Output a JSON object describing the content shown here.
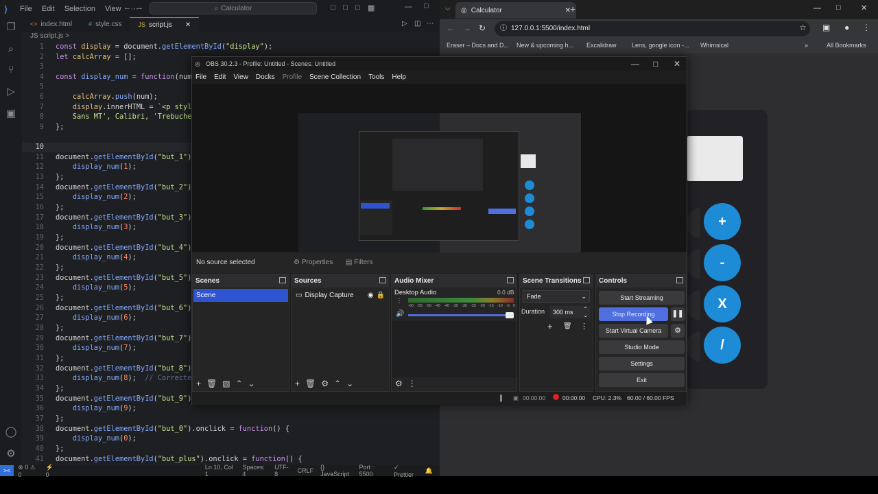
{
  "vscode": {
    "menus": [
      "File",
      "Edit",
      "Selection",
      "View",
      "···"
    ],
    "search_placeholder": "Calculator",
    "tabs": [
      {
        "label": "index.html",
        "active": false
      },
      {
        "label": "style.css",
        "active": false
      },
      {
        "label": "script.js",
        "active": true
      }
    ],
    "breadcrumb": "JS script.js >",
    "status": {
      "errors": "⊗ 0 ⚠ 0",
      "ports": "⚡ 0",
      "position": "Ln 10, Col 1",
      "spaces": "Spaces: 4",
      "encoding": "UTF-8",
      "eol": "CRLF",
      "language": "{} JavaScript",
      "port": "Port : 5500",
      "prettier": "✓ Prettier"
    }
  },
  "browser": {
    "tab_title": "Calculator",
    "url": "127.0.0.1:5500/index.html",
    "bookmarks": [
      "Eraser – Docs and D...",
      "New & upcoming h...",
      "Excalidraw",
      "Lens, google icon -...",
      "Whimsical"
    ],
    "all_bookmarks": "All Bookmarks",
    "calc_buttons": [
      "+",
      "-",
      "X",
      "/"
    ]
  },
  "obs": {
    "title": "OBS 30.2.3 - Profile: Untitled - Scenes: Untitled",
    "menu": [
      "File",
      "Edit",
      "View",
      "Docks",
      "Profile",
      "Scene Collection",
      "Tools",
      "Help"
    ],
    "no_source": "No source selected",
    "properties": "Properties",
    "filters": "Filters",
    "docks": {
      "scenes": {
        "title": "Scenes",
        "items": [
          "Scene"
        ]
      },
      "sources": {
        "title": "Sources",
        "items": [
          "Display Capture"
        ]
      },
      "mixer": {
        "title": "Audio Mixer",
        "channel": "Desktop Audio",
        "db": "0.0 dB",
        "ticks": [
          "-60",
          "-55",
          "-50",
          "-45",
          "-40",
          "-35",
          "-30",
          "-25",
          "-20",
          "-15",
          "-10",
          "-5",
          "0"
        ]
      },
      "transitions": {
        "title": "Scene Transitions",
        "type": "Fade",
        "duration_label": "Duration",
        "duration": "300 ms"
      },
      "controls": {
        "title": "Controls",
        "start_streaming": "Start Streaming",
        "stop_recording": "Stop Recording",
        "start_virtual_camera": "Start Virtual Camera",
        "studio_mode": "Studio Mode",
        "settings": "Settings",
        "exit": "Exit"
      }
    },
    "status": {
      "stream_time": "00:00:00",
      "rec_time": "00:00:00",
      "cpu": "CPU: 2.3%",
      "fps": "60.00 / 60.00 FPS"
    }
  },
  "colors": {
    "accent": "#2f6fd6",
    "obs_selected": "#2f54d1",
    "calc_button": "#1d8bd6",
    "stop_recording": "#4f6fe0"
  }
}
